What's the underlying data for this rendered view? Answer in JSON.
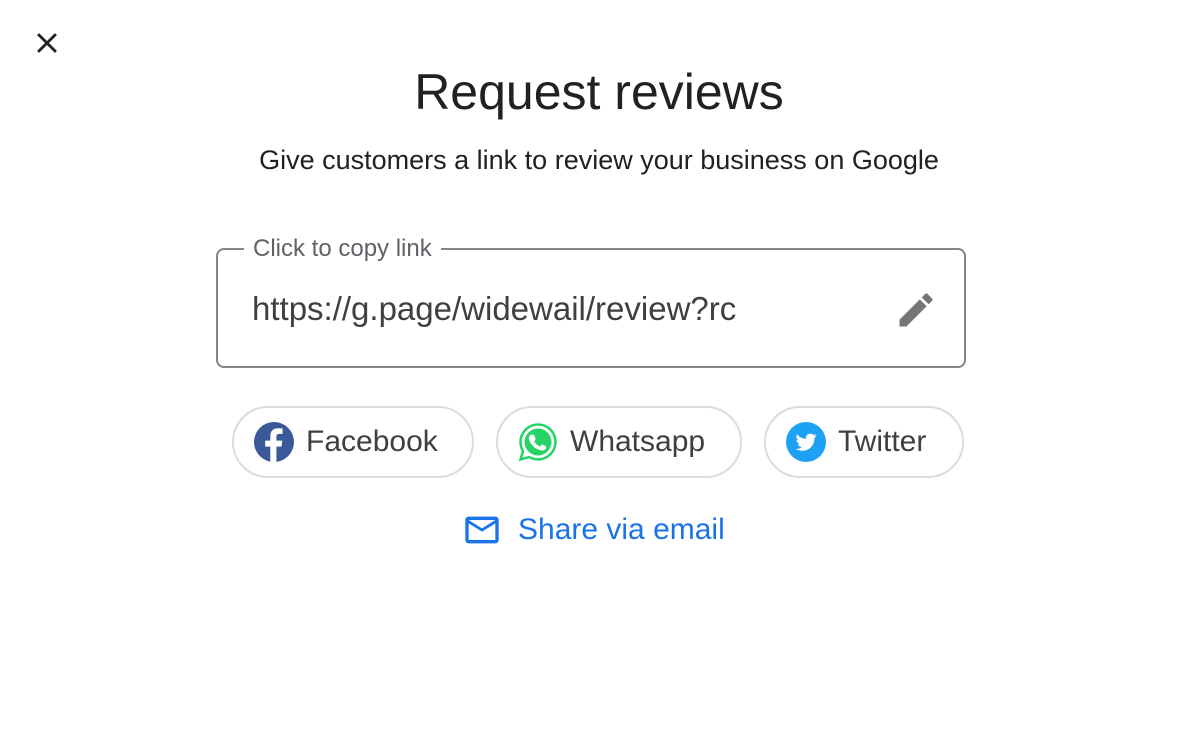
{
  "dialog": {
    "title": "Request reviews",
    "subtitle": "Give customers a link to review your business on Google"
  },
  "link_field": {
    "label": "Click to copy link",
    "value": "https://g.page/widewail/review?rc"
  },
  "share": {
    "facebook_label": "Facebook",
    "whatsapp_label": "Whatsapp",
    "twitter_label": "Twitter",
    "email_label": "Share via email"
  },
  "icons": {
    "close": "close-icon",
    "edit": "pencil-icon",
    "facebook": "facebook-logo-icon",
    "whatsapp": "whatsapp-logo-icon",
    "twitter": "twitter-logo-icon",
    "email": "mail-icon"
  },
  "colors": {
    "text_primary": "#202124",
    "text_secondary": "#5f6368",
    "link_blue": "#1a73e8",
    "border": "#80868b",
    "chip_border": "#dadce0",
    "facebook": "#3b5998",
    "whatsapp": "#25d366",
    "twitter": "#1da1f2"
  }
}
